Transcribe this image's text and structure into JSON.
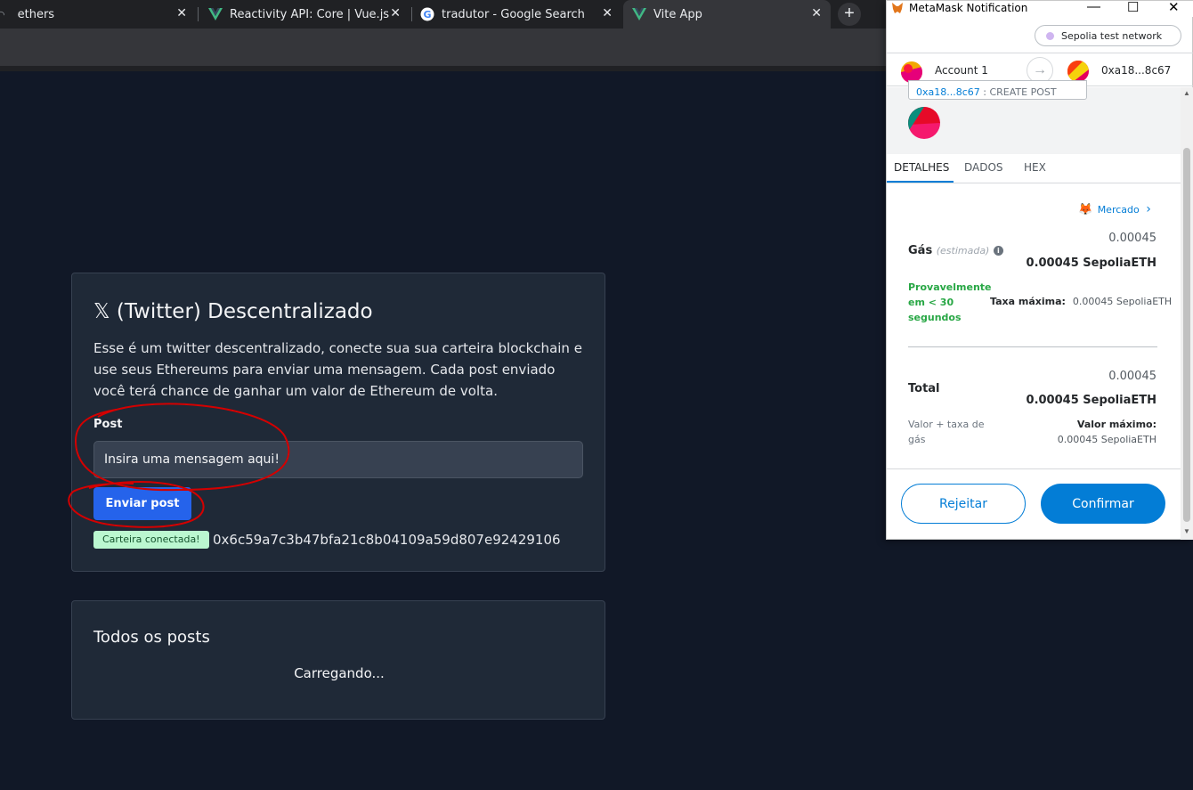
{
  "browser": {
    "tabs": [
      {
        "title": "ethers",
        "active": false
      },
      {
        "title": "Reactivity API: Core | Vue.js",
        "active": false
      },
      {
        "title": "tradutor - Google Search",
        "active": false
      },
      {
        "title": "Vite App",
        "active": true
      }
    ],
    "close_glyph": "✕",
    "new_tab_glyph": "+"
  },
  "page": {
    "title": "𝕏 (Twitter) Descentralizado",
    "description": "Esse é um twitter descentralizado, conecte sua sua carteira blockchain e use seus Ethereums para enviar uma mensagem. Cada post enviado você terá chance de ganhar um valor de Ethereum de volta.",
    "post_label": "Post",
    "post_placeholder": "Insira uma mensagem aqui!",
    "send_button": "Enviar post",
    "wallet_badge": "Carteira conectada!",
    "wallet_address": "0x6c59a7c3b47bfa21c8b04109a59d807e92429106",
    "posts_title": "Todos os posts",
    "posts_loading": "Carregando..."
  },
  "metamask": {
    "window_title": "MetaMask Notification",
    "window_controls": {
      "minimize": "—",
      "maximize": "☐",
      "close": "✕"
    },
    "network": "Sepolia test network",
    "from_account": "Account 1",
    "to_address": "0xa18...8c67",
    "arrow_glyph": "→",
    "action_address": "0xa18...8c67",
    "action_label": ": CREATE POST",
    "tabs": {
      "details": "DETALHES",
      "data": "DADOS",
      "hex": "HEX"
    },
    "market_link": "Mercado",
    "market_chevron": "›",
    "gas": {
      "label": "Gás",
      "estimated": "(estimada)",
      "info_glyph": "i",
      "value_small": "0.00045",
      "value_bold": "0.00045 SepoliaETH",
      "speed": "Provavelmente em < 30 segundos",
      "max_fee_label": "Taxa máxima:",
      "max_fee_value": "0.00045 SepoliaETH"
    },
    "total": {
      "label": "Total",
      "value_small": "0.00045",
      "value_bold": "0.00045 SepoliaETH",
      "sub_label": "Valor + taxa de gás",
      "max_label": "Valor máximo:",
      "max_value": "0.00045 SepoliaETH"
    },
    "reject_button": "Rejeitar",
    "confirm_button": "Confirmar"
  },
  "colors": {
    "page_bg": "#111827",
    "card_bg": "#1f2937",
    "primary_button": "#2563eb",
    "metamask_blue": "#037dd6",
    "annotation_red": "#d40000",
    "success_green": "#28a745"
  }
}
